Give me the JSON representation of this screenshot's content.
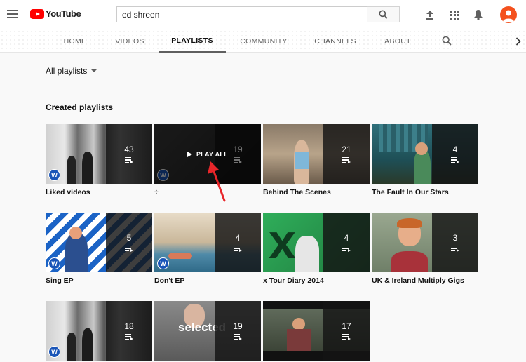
{
  "header": {
    "logo_text": "YouTube",
    "search_value": "ed shreen",
    "icons": [
      "menu-icon",
      "upload-icon",
      "apps-icon",
      "notifications-icon",
      "avatar"
    ]
  },
  "tabs": [
    {
      "label": "HOME",
      "active": false
    },
    {
      "label": "VIDEOS",
      "active": false
    },
    {
      "label": "PLAYLISTS",
      "active": true
    },
    {
      "label": "COMMUNITY",
      "active": false
    },
    {
      "label": "CHANNELS",
      "active": false
    },
    {
      "label": "ABOUT",
      "active": false
    }
  ],
  "sort_label": "All playlists",
  "section_title": "Created playlists",
  "hover_label": "PLAY ALL",
  "playlists": [
    {
      "title": "Liked videos",
      "count": "43",
      "badge": "W"
    },
    {
      "title": "÷",
      "count": "19",
      "badge": "W"
    },
    {
      "title": "Behind The Scenes",
      "count": "21"
    },
    {
      "title": "The Fault In Our Stars",
      "count": "4"
    },
    {
      "title": "Sing EP",
      "count": "5",
      "badge": "W"
    },
    {
      "title": "Don't EP",
      "count": "4",
      "badge": "W"
    },
    {
      "title": "x Tour Diary 2014",
      "count": "4"
    },
    {
      "title": "UK & Ireland Multiply Gigs",
      "count": "3"
    },
    {
      "title": "",
      "count": "18",
      "badge": "W"
    },
    {
      "title": "",
      "count": "19",
      "overlay_text": "selected"
    },
    {
      "title": "",
      "count": "17"
    }
  ],
  "colors": {
    "accent": "#ff0000",
    "avatar": "#f4511e",
    "badge": "#1a55b8",
    "annotation_arrow": "#e8262a"
  }
}
